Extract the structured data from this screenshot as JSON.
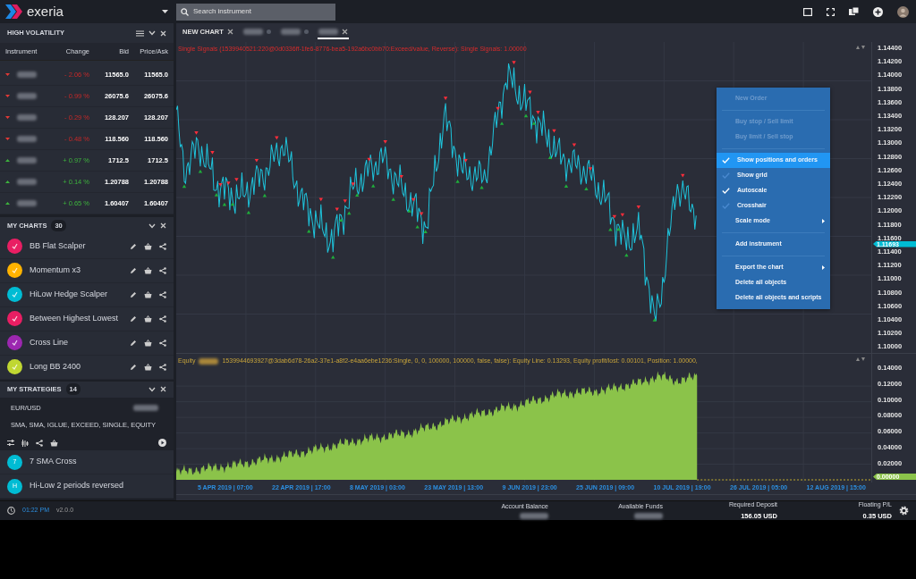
{
  "app": {
    "logo": "exeria"
  },
  "search": {
    "placeholder": "Search instrument"
  },
  "high_volatility": {
    "title": "HIGH VOLATILITY",
    "columns": [
      "Instrument",
      "Change",
      "Bid",
      "Price/Ask"
    ],
    "rows": [
      {
        "rising": false,
        "change": "- 2.06 %",
        "bid": "11565.0",
        "ask": "11565.0"
      },
      {
        "rising": false,
        "change": "- 0.99 %",
        "bid": "26075.6",
        "ask": "26075.6"
      },
      {
        "rising": false,
        "change": "- 0.29 %",
        "bid": "128.207",
        "ask": "128.207"
      },
      {
        "rising": false,
        "change": "- 0.48 %",
        "bid": "118.560",
        "ask": "118.560"
      },
      {
        "rising": true,
        "change": "+ 0.97 %",
        "bid": "1712.5",
        "ask": "1712.5"
      },
      {
        "rising": true,
        "change": "+ 0.14 %",
        "bid": "1.20788",
        "ask": "1.20788"
      },
      {
        "rising": true,
        "change": "+ 0.65 %",
        "bid": "1.60407",
        "ask": "1.60407"
      }
    ]
  },
  "my_charts": {
    "title": "MY CHARTS",
    "count": "30",
    "items": [
      {
        "name": "BB Flat Scalper",
        "color": "#e91e63"
      },
      {
        "name": "Momentum x3",
        "color": "#ffb300"
      },
      {
        "name": "HiLow Hedge Scalper",
        "color": "#00bcd4"
      },
      {
        "name": "Between Highest Lowest",
        "color": "#e91e63"
      },
      {
        "name": "Cross Line",
        "color": "#9c27b0"
      },
      {
        "name": "Long BB 2400",
        "color": "#c0d732"
      }
    ]
  },
  "my_strategies": {
    "title": "MY STRATEGIES",
    "count": "14",
    "symbol": "EUR/USD",
    "indicators": "SMA, SMA, IGLUE, EXCEED, SINGLE, EQUITY",
    "items": [
      {
        "badge": "7",
        "name": "7 SMA Cross"
      },
      {
        "badge": "H",
        "name": "Hi-Low 2 periods reversed"
      }
    ]
  },
  "chart_tabs": [
    {
      "label": "NEW CHART",
      "selected": false,
      "closable": true
    },
    {
      "selected": false,
      "closable": false
    },
    {
      "selected": false,
      "closable": false
    },
    {
      "selected": true,
      "closable": true
    }
  ],
  "price_pane": {
    "caption": "Single Signals (1539940521:220@0d0336ff-1fe6-8776-bea5-192a6bc0bb70:Exceed/value, Reverse): Single Signals: 1.00000",
    "yticks": [
      "1.14400",
      "1.14200",
      "1.14000",
      "1.13800",
      "1.13600",
      "1.13400",
      "1.13200",
      "1.13000",
      "1.12800",
      "1.12600",
      "1.12400",
      "1.12200",
      "1.12000",
      "1.11800",
      "1.11600",
      "1.11400",
      "1.11200",
      "1.11000",
      "1.10800",
      "1.10600",
      "1.10400",
      "1.10200",
      "1.10000"
    ],
    "last_price": "1.11693"
  },
  "equity_pane": {
    "caption_prefix": "Equity",
    "caption": "1539944693927@3dab6d78-26a2-37e1-a8f2-e4aa6ebe1236:Single, 0, 0, 100000, 100000, false, false): Equity Line: 0.13293, Equity profit/lost: 0.00101, Position: 1.00000,",
    "yticks": [
      "0.14000",
      "0.12000",
      "0.10000",
      "0.08000",
      "0.06000",
      "0.04000",
      "0.02000"
    ],
    "last_value": "0.00000"
  },
  "x_labels": [
    "5 APR 2019 | 07:00",
    "22 APR 2019 | 17:00",
    "8 MAY 2019 | 03:00",
    "23 MAY 2019 | 13:00",
    "9 JUN 2019 | 23:00",
    "25 JUN 2019 | 09:00",
    "10 JUL 2019 | 19:00",
    "26 JUL 2019 | 05:00",
    "12 AUG 2019 | 15:00"
  ],
  "context_menu": [
    {
      "kind": "item",
      "label": "New Order",
      "disabled": true
    },
    {
      "kind": "divider"
    },
    {
      "kind": "item",
      "label": "Buy stop / Sell limit",
      "disabled": true
    },
    {
      "kind": "item",
      "label": "Buy limit / Sell stop",
      "disabled": true
    },
    {
      "kind": "divider"
    },
    {
      "kind": "check",
      "label": "Show positions and orders",
      "checked": true,
      "selected": true
    },
    {
      "kind": "check",
      "label": "Show grid",
      "checked": false,
      "selected": false
    },
    {
      "kind": "check",
      "label": "Autoscale",
      "checked": true,
      "selected": false
    },
    {
      "kind": "check",
      "label": "Crosshair",
      "checked": false,
      "selected": false
    },
    {
      "kind": "submenu",
      "label": "Scale mode"
    },
    {
      "kind": "divider"
    },
    {
      "kind": "item",
      "label": "Add instrument",
      "disabled": false
    },
    {
      "kind": "divider"
    },
    {
      "kind": "submenu",
      "label": "Export the chart"
    },
    {
      "kind": "item",
      "label": "Delete all objects",
      "disabled": false
    },
    {
      "kind": "item",
      "label": "Delete all objects and scripts",
      "disabled": false
    }
  ],
  "status_bar": {
    "time": "01:22 PM",
    "version": "v2.0.0",
    "stats": [
      {
        "label": "Account Balance"
      },
      {
        "label": "Available Funds"
      },
      {
        "label": "Required Deposit",
        "value": "156.05 USD"
      },
      {
        "label": "Floating P/L",
        "value": "0.35 USD"
      }
    ]
  }
}
